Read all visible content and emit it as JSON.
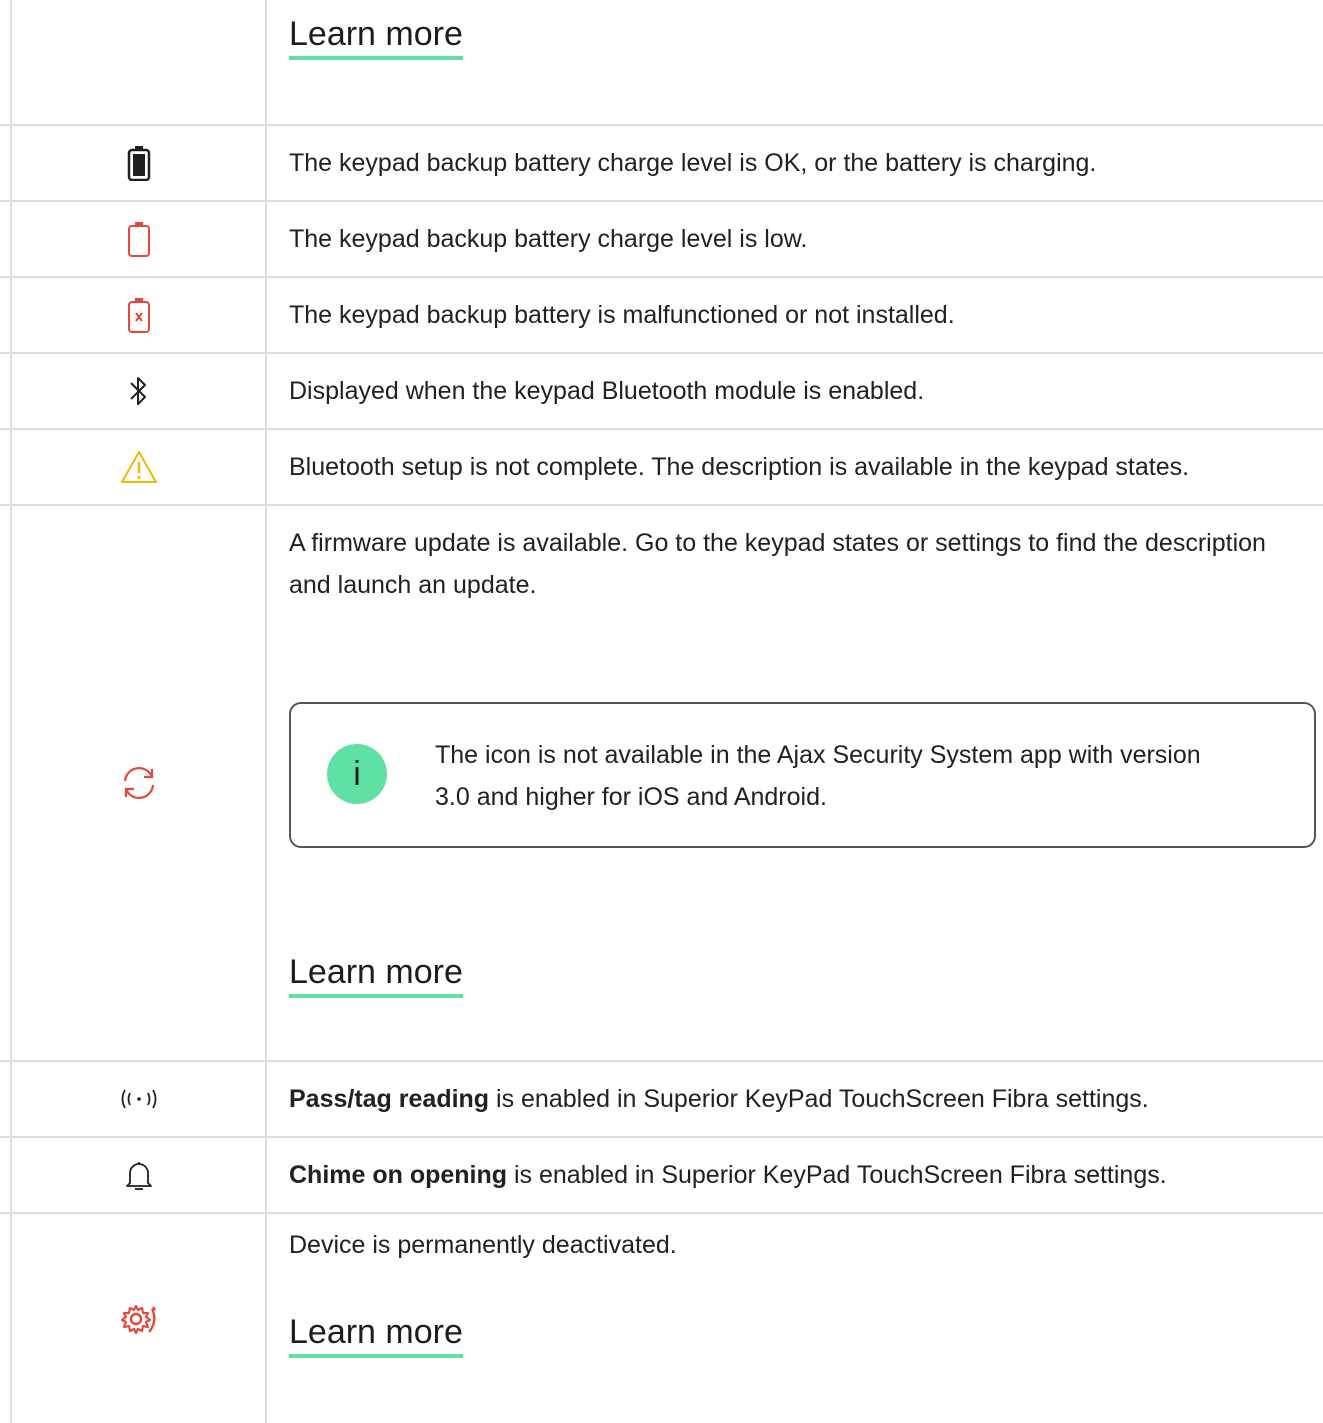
{
  "rows": {
    "top": {
      "learn_more": "Learn more"
    },
    "battery_ok": {
      "icon": "battery-full-icon",
      "text": "The keypad backup battery charge level is OK, or the battery is charging."
    },
    "battery_low": {
      "icon": "battery-low-icon",
      "text": "The keypad backup battery charge level is low."
    },
    "battery_fault": {
      "icon": "battery-fault-icon",
      "text": "The keypad backup battery is malfunctioned or not installed."
    },
    "bluetooth": {
      "icon": "bluetooth-icon",
      "text": "Displayed when the keypad Bluetooth module is enabled."
    },
    "bt_warning": {
      "icon": "warning-icon",
      "text": "Bluetooth setup is not complete. The description is available in the keypad states."
    },
    "firmware": {
      "icon": "update-icon",
      "text": "A firmware update is available. Go to the keypad states or settings to find the description and launch an update.",
      "note_icon": "info-icon",
      "note_badge": "i",
      "note": "The icon is not available in the Ajax Security System app with version 3.0 and higher for iOS and Android.",
      "learn_more": "Learn more"
    },
    "pass_tag": {
      "icon": "pass-tag-icon",
      "bold": "Pass/tag reading",
      "rest": " is enabled in Superior KeyPad TouchScreen Fibra settings."
    },
    "chime": {
      "icon": "bell-icon",
      "bold": "Chime on opening",
      "rest": " is enabled in Superior KeyPad TouchScreen Fibra settings."
    },
    "deactivated": {
      "icon": "gear-deactivated-icon",
      "text": "Device is permanently deactivated.",
      "learn_more": "Learn more"
    }
  },
  "colors": {
    "accent_green": "#5fe0a4",
    "red": "#e5483b",
    "amber": "#f2b705",
    "border": "#dcdcdc"
  }
}
